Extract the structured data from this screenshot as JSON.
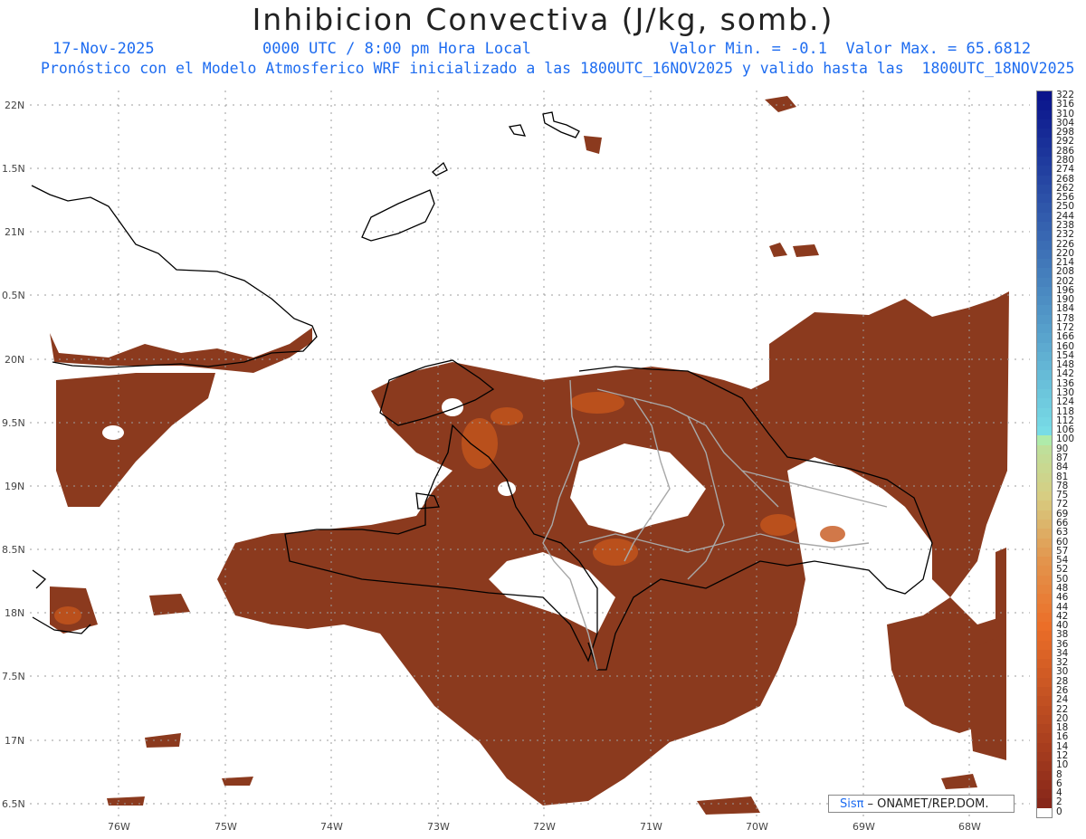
{
  "header": {
    "title": "Inhibicion Convectiva (J/kg, somb.)",
    "date": "17-Nov-2025",
    "time": "0000 UTC / 8:00 pm Hora Local",
    "minmax": "Valor Min. = -0.1  Valor Max. = 65.6812",
    "model": "Pronóstico con el Modelo Atmosferico WRF inicializado a las 1800UTC_16NOV2025 y valido hasta las  1800UTC_18NOV2025"
  },
  "map": {
    "lat_labels": [
      "22N",
      "1.5N",
      "21N",
      "0.5N",
      "20N",
      "9.5N",
      "19N",
      "8.5N",
      "18N",
      "7.5N",
      "17N",
      "6.5N"
    ],
    "lon_labels": [
      "76W",
      "75W",
      "74W",
      "73W",
      "72W",
      "71W",
      "70W",
      "69W",
      "68W"
    ],
    "field_color": "#8b3a1e",
    "field_hot_color": "#d9681e",
    "coast_color": "#000000",
    "border_color": "#9e9e9e"
  },
  "colorbar": {
    "labels": [
      "322",
      "316",
      "310",
      "304",
      "298",
      "292",
      "286",
      "280",
      "274",
      "268",
      "262",
      "256",
      "250",
      "244",
      "238",
      "232",
      "226",
      "220",
      "214",
      "208",
      "202",
      "196",
      "190",
      "184",
      "178",
      "172",
      "166",
      "160",
      "154",
      "148",
      "142",
      "136",
      "130",
      "124",
      "118",
      "112",
      "106",
      "100",
      "90",
      "87",
      "84",
      "81",
      "78",
      "75",
      "72",
      "69",
      "66",
      "63",
      "60",
      "57",
      "54",
      "52",
      "50",
      "48",
      "46",
      "44",
      "42",
      "40",
      "38",
      "36",
      "34",
      "32",
      "30",
      "28",
      "26",
      "24",
      "22",
      "20",
      "18",
      "16",
      "14",
      "12",
      "10",
      "8",
      "6",
      "4",
      "2",
      "0"
    ]
  },
  "credit": {
    "sis": "Sisπ",
    "text": "– ONAMET/REP.DOM."
  }
}
